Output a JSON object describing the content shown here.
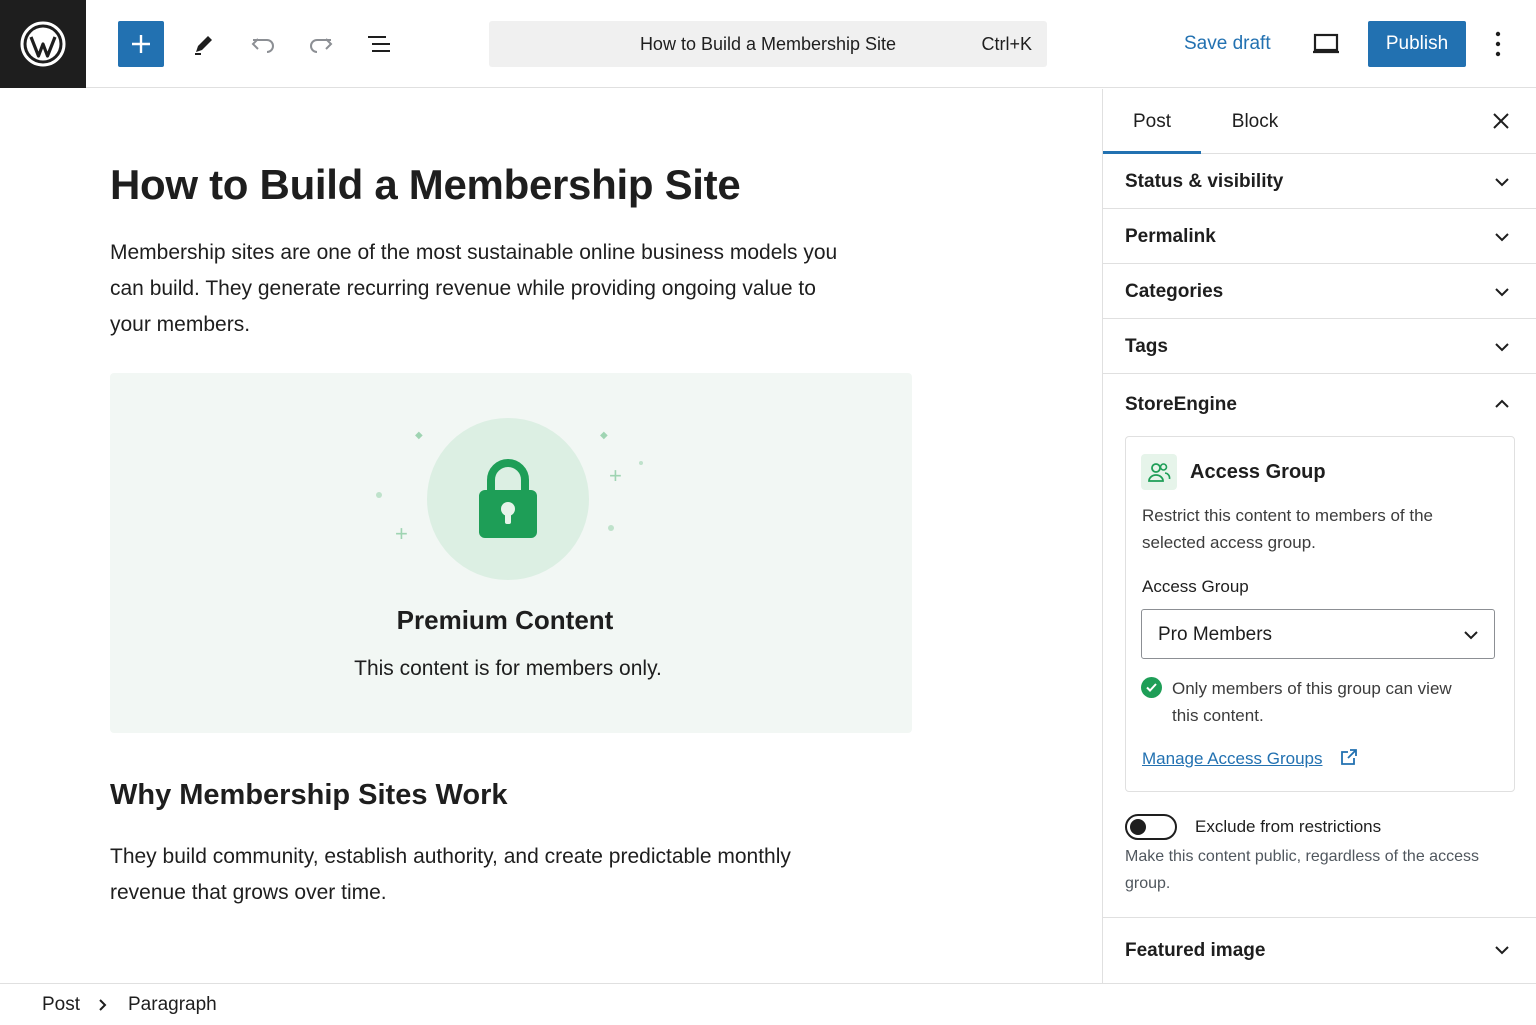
{
  "header": {
    "document_title": "How to Build a Membership Site",
    "shortcut": "Ctrl+K",
    "save_draft": "Save draft",
    "publish": "Publish",
    "icons": [
      "wordpress-logo",
      "plus-icon",
      "pencil-icon",
      "undo-icon",
      "redo-icon",
      "list-view-icon",
      "desktop-preview-icon",
      "more-vertical-icon"
    ],
    "accent_color": "#2271b1"
  },
  "editor": {
    "title": "How to Build a Membership Site",
    "intro": "Membership sites are one of the most sustainable online business models you can build. They generate recurring revenue while providing ongoing value to your members.",
    "locked_block": {
      "title": "Premium Content",
      "subtitle": "This content is for members only.",
      "icon": "lock-icon",
      "color": "#1e9e57"
    },
    "heading": "Why Membership Sites Work",
    "body": "They build community, establish authority, and create predictable monthly revenue that grows over time."
  },
  "footer": {
    "breadcrumb": [
      "Post",
      "Paragraph"
    ]
  },
  "sidebar": {
    "tabs": [
      {
        "label": "Post",
        "active": true
      },
      {
        "label": "Block",
        "active": false
      }
    ],
    "panels": [
      {
        "label": "Status & visibility",
        "expanded": false
      },
      {
        "label": "Permalink",
        "expanded": false
      },
      {
        "label": "Categories",
        "expanded": false
      },
      {
        "label": "Tags",
        "expanded": false
      },
      {
        "label": "StoreEngine",
        "expanded": true
      },
      {
        "label": "Featured image",
        "expanded": false
      }
    ],
    "storeengine": {
      "card_title": "Access Group",
      "card_description": "Restrict this content to members of the selected access group.",
      "field_label": "Access Group",
      "selected_group": "Pro Members",
      "notice": "Only members of this group can view this content.",
      "manage_link": "Manage Access Groups",
      "toggle_label": "Exclude from restrictions",
      "toggle_on": false,
      "toggle_help": "Make this content public, regardless of the access group."
    }
  }
}
